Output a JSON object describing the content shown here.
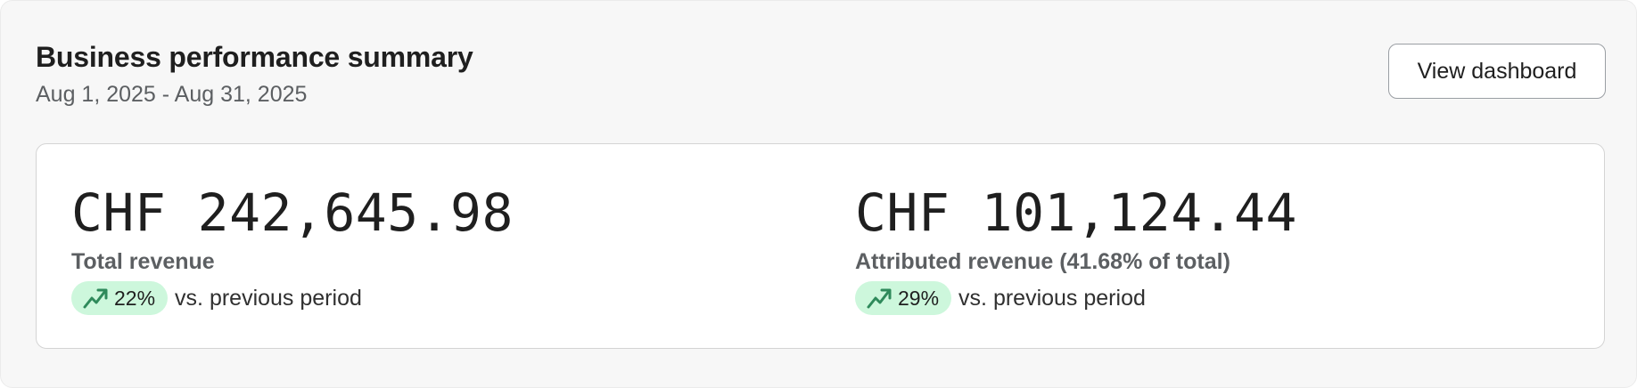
{
  "summary": {
    "title": "Business performance summary",
    "date_range": "Aug 1, 2025 - Aug 31, 2025",
    "view_button_label": "View dashboard"
  },
  "metrics": [
    {
      "value": "CHF 242,645.98",
      "label": "Total revenue",
      "change": "22%",
      "change_direction": "up",
      "comparison_text": "vs. previous period"
    },
    {
      "value": "CHF 101,124.44",
      "label": "Attributed revenue (41.68% of total)",
      "change": "29%",
      "change_direction": "up",
      "comparison_text": "vs. previous period"
    }
  ],
  "colors": {
    "badge_background": "#cdf7dc",
    "trend_icon": "#2f8a5b",
    "card_background": "#f7f7f7"
  },
  "icons": {
    "trend": "trending-up-icon"
  }
}
